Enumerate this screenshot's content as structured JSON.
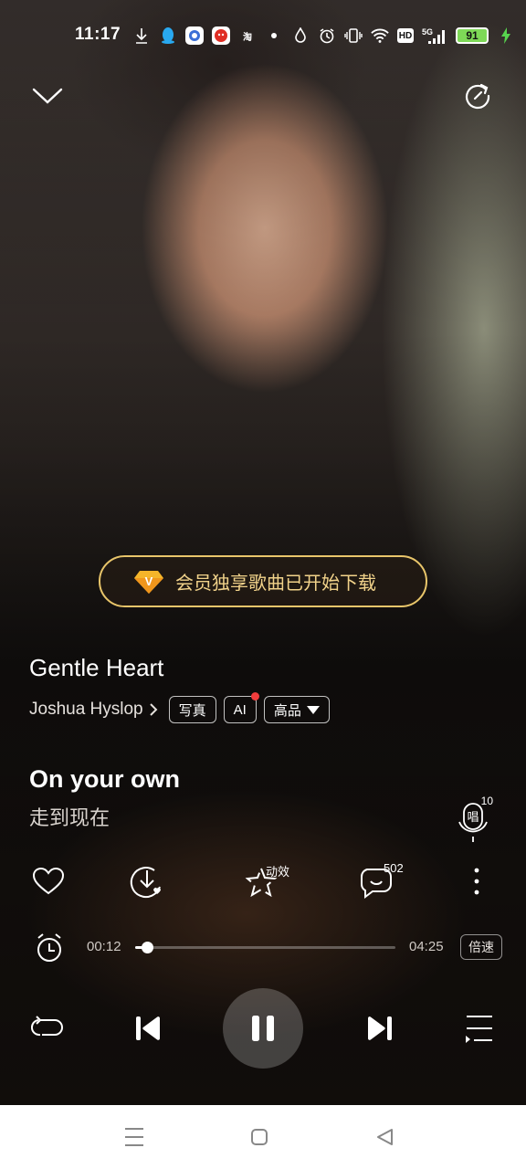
{
  "status_bar": {
    "time": "11:17",
    "battery_level": "91",
    "app_badges": [
      "淘"
    ],
    "network": "5G",
    "hd": "HD"
  },
  "vip_banner": {
    "icon_glyph": "V",
    "text": "会员独享歌曲已开始下载",
    "accent_color": "#e8c56a"
  },
  "song": {
    "title": "Gentle Heart",
    "artist": "Joshua Hyslop",
    "tags": [
      "写真",
      "AI",
      "高品"
    ]
  },
  "lyrics": {
    "current": "On your own",
    "translation": "走到现在"
  },
  "sing": {
    "count": "10",
    "label": "唱"
  },
  "actions": {
    "effect_label": "动效",
    "comment_count": "502"
  },
  "progress": {
    "elapsed": "00:12",
    "total": "04:25",
    "fraction": 0.047,
    "speed_label": "倍速"
  }
}
